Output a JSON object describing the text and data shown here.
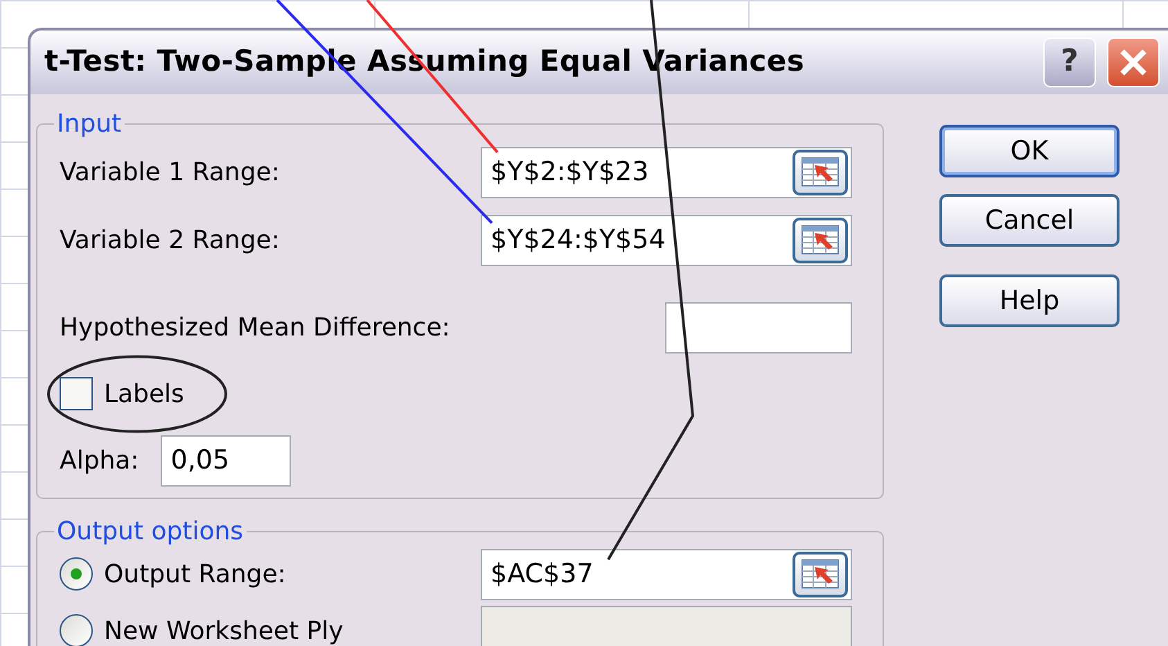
{
  "window": {
    "title": "t-Test: Two-Sample Assuming Equal Variances",
    "title_buttons": [
      {
        "kind": "help",
        "label": "?"
      },
      {
        "kind": "close"
      }
    ]
  },
  "input": {
    "title": "Input",
    "rows": [
      {
        "kind": "range",
        "label": "Variable 1 Range:",
        "value": "$Y$2:$Y$23"
      },
      {
        "kind": "range",
        "label": "Variable 2 Range:",
        "value": "$Y$24:$Y$54"
      },
      {
        "kind": "text",
        "label": "Hypothesized Mean Difference:"
      },
      {
        "kind": "checkbox",
        "label": "Labels",
        "checked": false
      },
      {
        "kind": "short",
        "label": "Alpha:",
        "value": "0,05"
      }
    ]
  },
  "output": {
    "title": "Output options",
    "options": [
      {
        "label": "Output Range:",
        "selected": true,
        "value": "$AC$37",
        "disabled": false
      },
      {
        "label": "New Worksheet Ply",
        "selected": false,
        "disabled": true
      }
    ]
  },
  "buttons": [
    {
      "label": "OK",
      "default": true
    },
    {
      "label": "Cancel",
      "default": false
    },
    {
      "label": "Help",
      "default": false
    }
  ]
}
